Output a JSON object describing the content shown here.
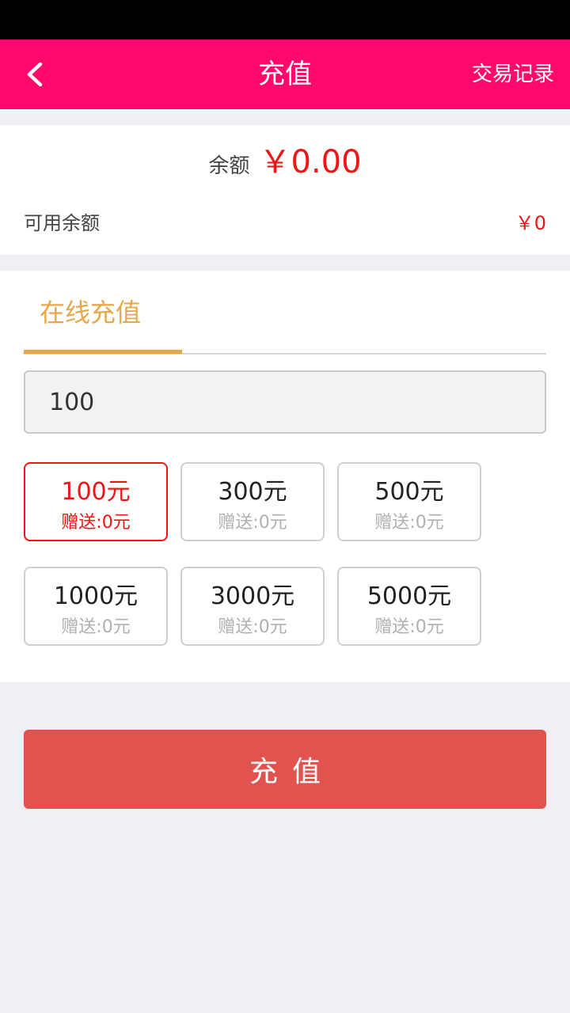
{
  "header": {
    "title": "充值",
    "history_label": "交易记录",
    "back_icon": "chevron-left-icon"
  },
  "balance": {
    "label": "余额",
    "value": "￥0.00",
    "available_label": "可用余额",
    "available_value": "￥0"
  },
  "recharge": {
    "tab_label": "在线充值",
    "amount_value": "100",
    "options": [
      {
        "amount": "100元",
        "bonus": "赠送:0元",
        "selected": true
      },
      {
        "amount": "300元",
        "bonus": "赠送:0元",
        "selected": false
      },
      {
        "amount": "500元",
        "bonus": "赠送:0元",
        "selected": false
      },
      {
        "amount": "1000元",
        "bonus": "赠送:0元",
        "selected": false
      },
      {
        "amount": "3000元",
        "bonus": "赠送:0元",
        "selected": false
      },
      {
        "amount": "5000元",
        "bonus": "赠送:0元",
        "selected": false
      }
    ],
    "submit_label": "充值"
  },
  "colors": {
    "header_bg": "#ff0a6c",
    "accent_red": "#f01414",
    "tab_orange": "#e8a84a",
    "button_red": "#e0534f"
  }
}
